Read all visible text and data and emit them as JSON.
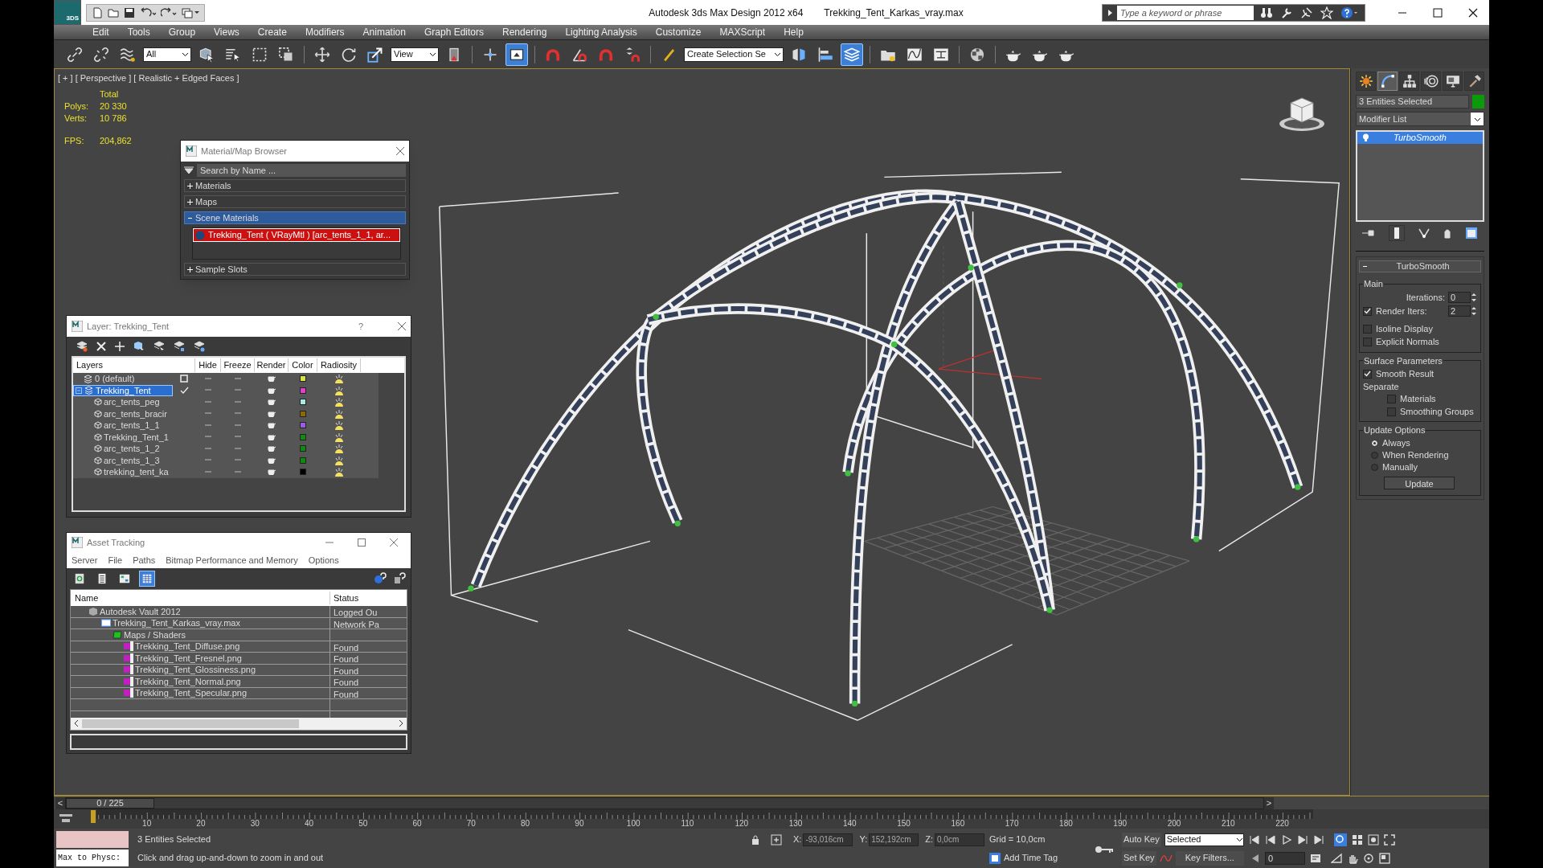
{
  "window": {
    "app_badge": "3DS",
    "title": "Autodesk 3ds Max Design 2012 x64",
    "file": "Trekking_Tent_Karkas_vray.max"
  },
  "search": {
    "placeholder": "Type a keyword or phrase"
  },
  "menu": [
    "Edit",
    "Tools",
    "Group",
    "Views",
    "Create",
    "Modifiers",
    "Animation",
    "Graph Editors",
    "Rendering",
    "Lighting Analysis",
    "Customize",
    "MAXScript",
    "Help"
  ],
  "toolbar": [
    {
      "kind": "button",
      "selected": false
    },
    {
      "kind": "button",
      "selected": false
    },
    {
      "kind": "button",
      "selected": false
    },
    {
      "kind": "dropdown",
      "value": "All"
    },
    {
      "kind": "button",
      "selected": false
    },
    {
      "kind": "button",
      "selected": false
    },
    {
      "kind": "button",
      "selected": false
    },
    {
      "kind": "button",
      "selected": false
    },
    {
      "kind": "separator"
    },
    {
      "kind": "button",
      "selected": false
    },
    {
      "kind": "button",
      "selected": false
    },
    {
      "kind": "button",
      "selected": false
    },
    {
      "kind": "dropdown",
      "value": "View"
    },
    {
      "kind": "button",
      "selected": false
    },
    {
      "kind": "separator"
    },
    {
      "kind": "button",
      "selected": false
    },
    {
      "kind": "button",
      "selected": true
    },
    {
      "kind": "separator"
    },
    {
      "kind": "button",
      "selected": false
    },
    {
      "kind": "button",
      "selected": false
    },
    {
      "kind": "button",
      "selected": false
    },
    {
      "kind": "button",
      "selected": false
    },
    {
      "kind": "separator"
    },
    {
      "kind": "button",
      "selected": false
    },
    {
      "kind": "dropdown",
      "value": "Create Selection Se"
    },
    {
      "kind": "button",
      "selected": false
    },
    {
      "kind": "button",
      "selected": false
    },
    {
      "kind": "button",
      "selected": true
    },
    {
      "kind": "separator"
    },
    {
      "kind": "button",
      "selected": false
    },
    {
      "kind": "button",
      "selected": false
    },
    {
      "kind": "button",
      "selected": false
    },
    {
      "kind": "separator"
    },
    {
      "kind": "button",
      "selected": false
    },
    {
      "kind": "separator"
    },
    {
      "kind": "button",
      "selected": false
    },
    {
      "kind": "button",
      "selected": false
    },
    {
      "kind": "button",
      "selected": false
    }
  ],
  "viewport": {
    "labels": [
      "[ + ]",
      "[ Perspective ]",
      "[ Realistic + Edged Faces ]"
    ],
    "stats_header": "Total",
    "stats": [
      {
        "label": "Polys:",
        "value": "20 330"
      },
      {
        "label": "Verts:",
        "value": "10 786"
      }
    ],
    "fps_label": "FPS:",
    "fps_value": "204,862"
  },
  "material_browser": {
    "title": "Material/Map Browser",
    "search_placeholder": "Search by Name ...",
    "groups": [
      {
        "label": "Materials",
        "expanded": false
      },
      {
        "label": "Maps",
        "expanded": false
      },
      {
        "label": "Scene Materials",
        "expanded": true,
        "items": [
          "Trekking_Tent  ( VRayMtl ) [arc_tents_1_1, ar..."
        ]
      },
      {
        "label": "Sample Slots",
        "expanded": false
      }
    ]
  },
  "layer_window": {
    "title": "Layer: Trekking_Tent",
    "help": "?",
    "columns": [
      "Layers",
      "Hide",
      "Freeze",
      "Render",
      "Color",
      "Radiosity"
    ],
    "layers": [
      {
        "kind": "layer",
        "name": "0 (default)",
        "selected": false,
        "current": false,
        "color": "#d6e44a"
      },
      {
        "kind": "layer",
        "name": "Trekking_Tent",
        "selected": true,
        "current": true,
        "color": "#e040c8",
        "children": [
          {
            "kind": "object",
            "name": "arc_tents_peg",
            "color": "#a8ecdf"
          },
          {
            "kind": "object",
            "name": "arc_tents_bracir",
            "color": "#8a6a08"
          },
          {
            "kind": "object",
            "name": "arc_tents_1_1",
            "color": "#9a5ae6"
          },
          {
            "kind": "object",
            "name": "Trekking_Tent_1",
            "color": "#0e8a10"
          },
          {
            "kind": "object",
            "name": "arc_tents_1_2",
            "color": "#0e8a10"
          },
          {
            "kind": "object",
            "name": "arc_tents_1_3",
            "color": "#0e8a10"
          },
          {
            "kind": "object",
            "name": "trekking_tent_ka",
            "color": "#000000"
          }
        ]
      }
    ]
  },
  "asset_window": {
    "title": "Asset Tracking",
    "menu": [
      "Server",
      "File",
      "Paths",
      "Bitmap Performance and Memory",
      "Options"
    ],
    "view_buttons": [
      {
        "selected": false
      },
      {
        "selected": false
      },
      {
        "selected": false
      },
      {
        "selected": true
      }
    ],
    "columns": [
      "Name",
      "Status"
    ],
    "rows": [
      {
        "kind": "vault",
        "name": "Autodesk Vault 2012",
        "status": "Logged Ou",
        "children": [
          {
            "kind": "scene",
            "name": "Trekking_Tent_Karkas_vray.max",
            "status": "Network Pa",
            "children": [
              {
                "kind": "folder",
                "name": "Maps / Shaders",
                "children": [
                  {
                    "kind": "png",
                    "name": "Trekking_Tent_Diffuse.png",
                    "status": "Found"
                  },
                  {
                    "kind": "png",
                    "name": "Trekking_Tent_Fresnel.png",
                    "status": "Found"
                  },
                  {
                    "kind": "png",
                    "name": "Trekking_Tent_Glossiness.png",
                    "status": "Found"
                  },
                  {
                    "kind": "png",
                    "name": "Trekking_Tent_Normal.png",
                    "status": "Found"
                  },
                  {
                    "kind": "png",
                    "name": "Trekking_Tent_Specular.png",
                    "status": "Found"
                  }
                ]
              }
            ]
          }
        ]
      }
    ]
  },
  "command_panel": {
    "tabs": [
      {
        "selected": false
      },
      {
        "selected": true
      },
      {
        "selected": false
      },
      {
        "selected": false
      },
      {
        "selected": false
      },
      {
        "selected": false
      }
    ],
    "object_name": "3 Entities Selected",
    "modifier_list": "Modifier List",
    "stack": [
      {
        "name": "TurboSmooth",
        "selected": true
      }
    ],
    "rollout": {
      "title": "TurboSmooth",
      "expanded": true,
      "main": {
        "title": "Main",
        "iterations": {
          "label": "Iterations:",
          "value": "0"
        },
        "render_iters": {
          "label": "Render Iters:",
          "value": "2",
          "checked": true
        },
        "checks": [
          {
            "label": "Isoline Display",
            "checked": false
          },
          {
            "label": "Explicit Normals",
            "checked": false
          }
        ]
      },
      "surface": {
        "title": "Surface Parameters",
        "smooth_result": {
          "label": "Smooth Result",
          "checked": true
        },
        "separate_label": "Separate",
        "separate": [
          {
            "label": "Materials",
            "checked": false
          },
          {
            "label": "Smoothing Groups",
            "checked": false
          }
        ]
      },
      "update": {
        "title": "Update Options",
        "options": [
          {
            "label": "Always",
            "selected": true
          },
          {
            "label": "When Rendering",
            "selected": false
          },
          {
            "label": "Manually",
            "selected": false
          }
        ],
        "button": "Update"
      }
    }
  },
  "timeline": {
    "prev": "<",
    "position": "0 / 225",
    "level": 0,
    "next": ">",
    "ticks": [
      "10",
      "20",
      "30",
      "40",
      "50",
      "60",
      "70",
      "80",
      "90",
      "100",
      "110",
      "120",
      "130",
      "140",
      "150",
      "160",
      "170",
      "180",
      "190",
      "200",
      "210",
      "220"
    ]
  },
  "status_bar": {
    "listener": "Max to Physc:",
    "selection": "3 Entities Selected",
    "prompt": "Click and drag up-and-down to zoom in and out",
    "coords": [
      {
        "label": "X:",
        "value": "-93,016cm"
      },
      {
        "label": "Y:",
        "value": "152,192cm"
      },
      {
        "label": "Z:",
        "value": "0,0cm"
      }
    ],
    "grid": "Grid = 10,0cm",
    "time_tag": "Add Time Tag",
    "auto_key": "Auto Key",
    "key_mode": "Selected",
    "set_key": "Set Key",
    "key_filters": "Key Filters...",
    "frame": "0"
  }
}
